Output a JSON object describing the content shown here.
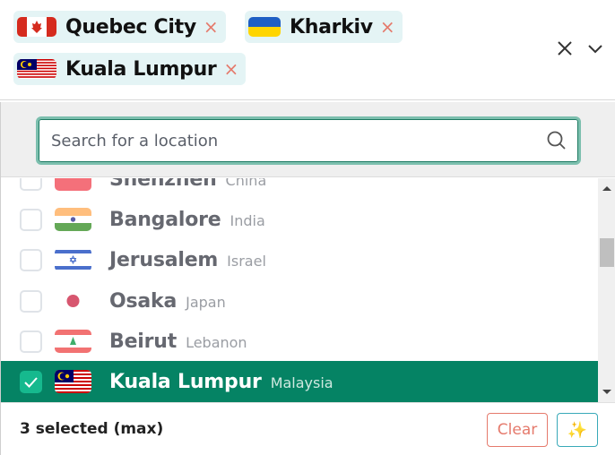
{
  "selected_chips": [
    {
      "name": "Quebec City",
      "flag": "canada",
      "remove": "×"
    },
    {
      "name": "Kharkiv",
      "flag": "ukraine",
      "remove": "×"
    },
    {
      "name": "Kuala Lumpur",
      "flag": "malaysia",
      "remove": "×"
    }
  ],
  "header_controls": {
    "clear_all_icon": "close-icon",
    "toggle_icon": "chevron-down-icon"
  },
  "search": {
    "placeholder": "Search for a location",
    "value": "",
    "icon": "search-icon"
  },
  "options": [
    {
      "city": "Shenzhen",
      "country": "China",
      "flag": "china",
      "checked": false
    },
    {
      "city": "Bangalore",
      "country": "India",
      "flag": "india",
      "checked": false
    },
    {
      "city": "Jerusalem",
      "country": "Israel",
      "flag": "israel",
      "checked": false
    },
    {
      "city": "Osaka",
      "country": "Japan",
      "flag": "japan",
      "checked": false
    },
    {
      "city": "Beirut",
      "country": "Lebanon",
      "flag": "lebanon",
      "checked": false
    },
    {
      "city": "Kuala Lumpur",
      "country": "Malaysia",
      "flag": "malaysia",
      "checked": true
    }
  ],
  "footer": {
    "count_label": "3 selected (max)",
    "clear_label": "Clear",
    "magic_icon": "✨"
  },
  "colors": {
    "accent": "#058364",
    "chip_bg": "#e4f4f5",
    "remove": "#e57a6c",
    "focus_ring": "#7cbfae"
  }
}
